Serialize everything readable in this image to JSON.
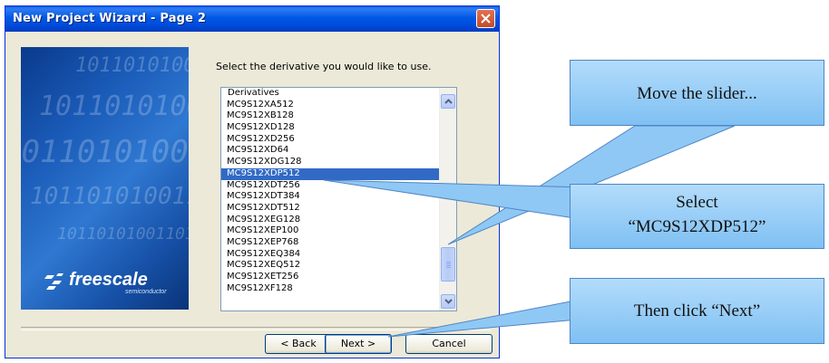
{
  "window": {
    "title": "New Project Wizard - Page  2"
  },
  "banner": {
    "logo_text": "freescale",
    "logo_subtext": "semiconductor",
    "binary_text": "10110101001101"
  },
  "instruction": "Select the derivative you would like to use.",
  "listbox": {
    "header": "Derivatives",
    "items": [
      "MC9S12XA512",
      "MC9S12XB128",
      "MC9S12XD128",
      "MC9S12XD256",
      "MC9S12XD64",
      "MC9S12XDG128",
      "MC9S12XDP512",
      "MC9S12XDT256",
      "MC9S12XDT384",
      "MC9S12XDT512",
      "MC9S12XEG128",
      "MC9S12XEP100",
      "MC9S12XEP768",
      "MC9S12XEQ384",
      "MC9S12XEQ512",
      "MC9S12XET256",
      "MC9S12XF128"
    ],
    "selected": "MC9S12XDP512"
  },
  "buttons": {
    "back": "< Back",
    "next": "Next >",
    "cancel": "Cancel"
  },
  "callouts": {
    "slider": "Move the slider...",
    "select_line1": "Select",
    "select_line2": "“MC9S12XDP512”",
    "next": "Then click “Next”"
  },
  "colors": {
    "titlebar": "#0058e6",
    "selection": "#316ac5",
    "callout": "#9fd0f8"
  }
}
